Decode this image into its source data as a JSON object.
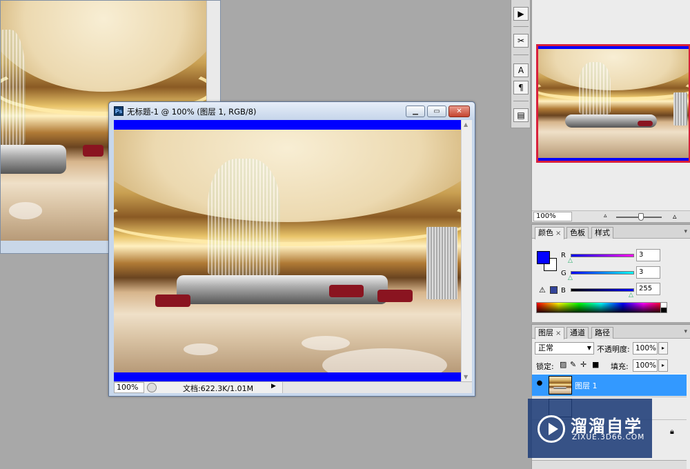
{
  "background_document": {
    "image_name": "hotel-lobby-interior"
  },
  "document_window": {
    "title": "无标题-1 @ 100% (图层 1, RGB/8)",
    "app_icon_label": "Ps",
    "minimize_icon": "minimize-icon",
    "maximize_icon": "maximize-icon",
    "close_icon": "close-icon",
    "canvas_color": "#0000ff",
    "status": {
      "zoom": "100%",
      "doc_info": "文档:622.3K/1.01M"
    }
  },
  "tools_strip": {
    "icons": [
      "play-icon",
      "tools-icon",
      "character-icon",
      "paragraph-icon",
      "layer-comps-icon"
    ]
  },
  "navigator": {
    "zoom": "100%",
    "zoom_slider_fraction": 0.5,
    "view_box_color": "#d8203c"
  },
  "color_panel": {
    "tabs": [
      "颜色",
      "色板",
      "样式"
    ],
    "foreground_color": "#0303ff",
    "background_color": "#ffffff",
    "channels": [
      {
        "label": "R",
        "value": "3"
      },
      {
        "label": "G",
        "value": "3"
      },
      {
        "label": "B",
        "value": "255"
      }
    ],
    "gamut_warning_color": "#33449a"
  },
  "layers_panel": {
    "tabs": [
      "图层",
      "通道",
      "路径"
    ],
    "blend_mode": "正常",
    "opacity_label": "不透明度:",
    "opacity": "100%",
    "lock_label": "锁定:",
    "fill_label": "填充:",
    "fill": "100%",
    "layers": [
      {
        "name": "图层 1",
        "visible": true,
        "selected": true
      }
    ]
  },
  "watermark": {
    "brand": "溜溜自学",
    "site": "ZIXUE.3D66.COM"
  }
}
